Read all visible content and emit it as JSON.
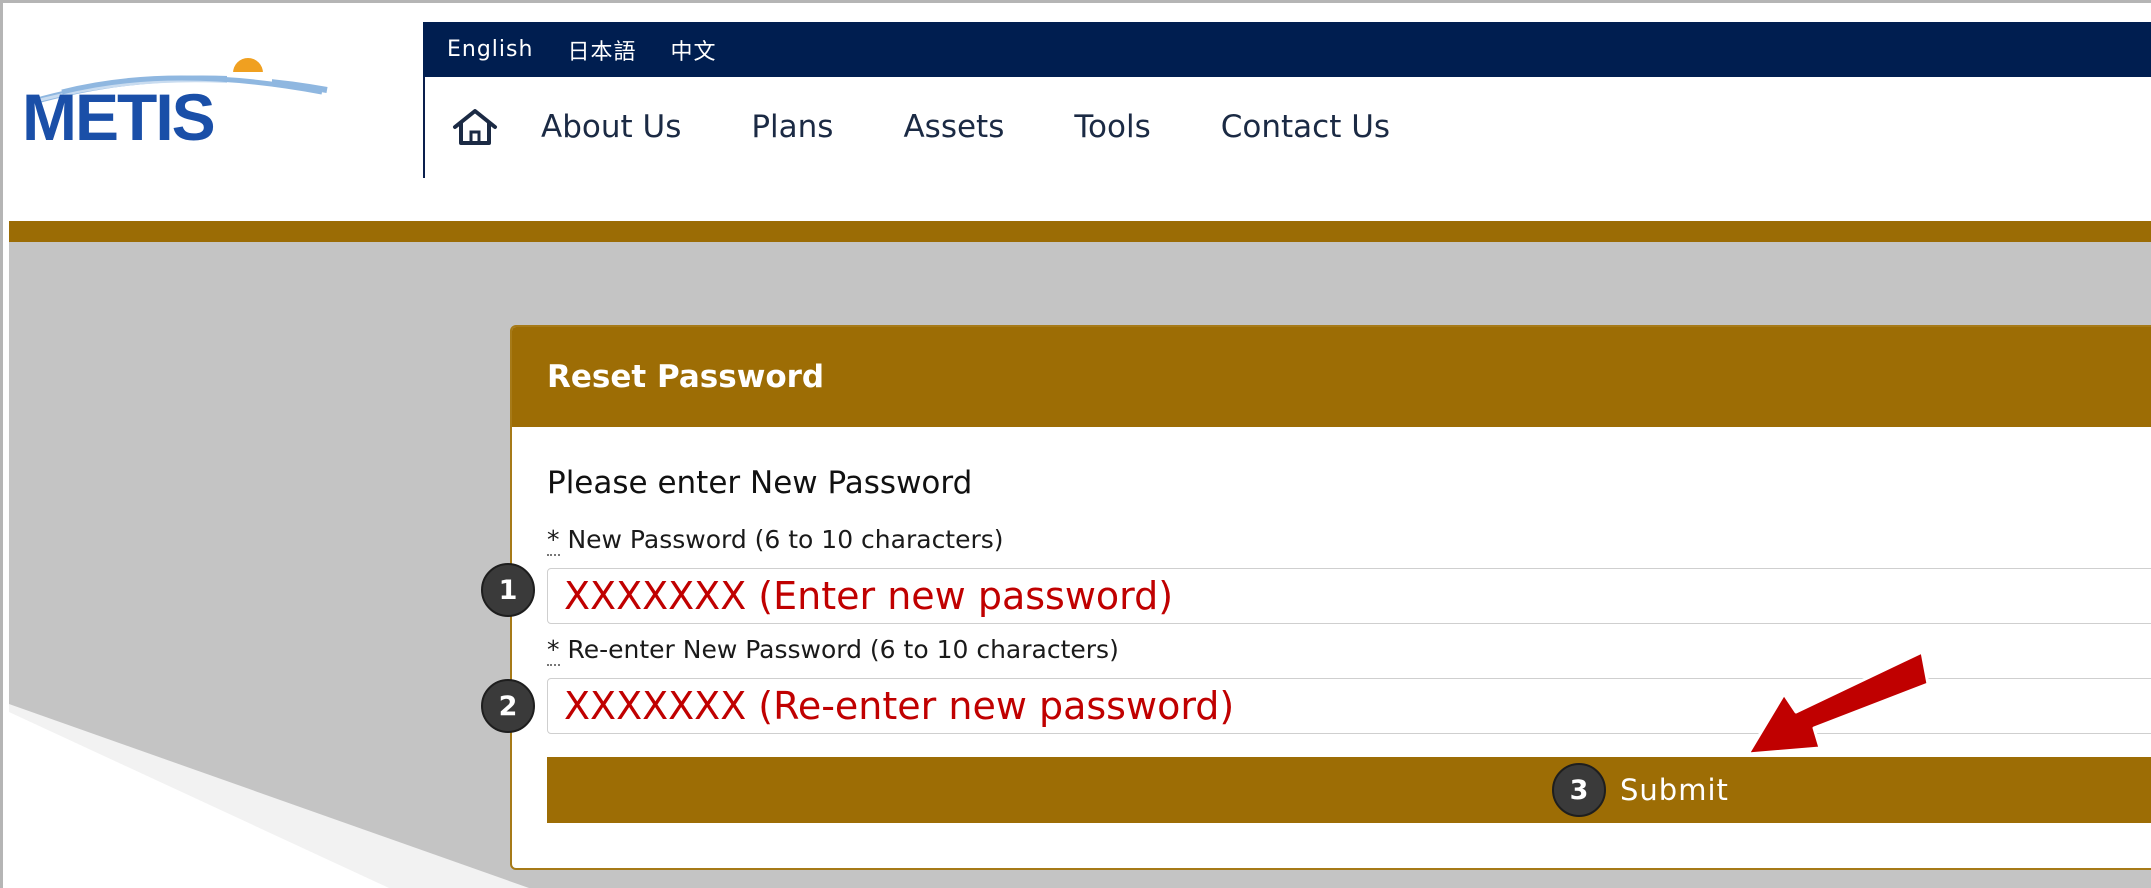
{
  "header": {
    "logo_text": "METIS",
    "languages": [
      "English",
      "日本語",
      "中文"
    ],
    "nav": {
      "home_icon": "home-icon",
      "items": [
        "About Us",
        "Plans",
        "Assets",
        "Tools",
        "Contact Us"
      ]
    }
  },
  "card": {
    "title": "Reset Password",
    "subtitle": "Please enter New Password",
    "fields": [
      {
        "required_marker": "*",
        "label": "New Password (6 to 10 characters)",
        "value": "XXXXXXX (Enter new password)",
        "step": "1"
      },
      {
        "required_marker": "*",
        "label": "Re-enter New Password (6 to 10 characters)",
        "value": "XXXXXXX (Re-enter new password)",
        "step": "2"
      }
    ],
    "submit": {
      "step": "3",
      "label": "Submit"
    }
  },
  "annotation": {
    "arrow_icon": "red-arrow-icon"
  },
  "colors": {
    "navy": "#001e50",
    "gold": "#9d6d05",
    "annotation_red": "#c00000",
    "logo_blue": "#1a4fa8",
    "logo_sun": "#f0a020"
  }
}
